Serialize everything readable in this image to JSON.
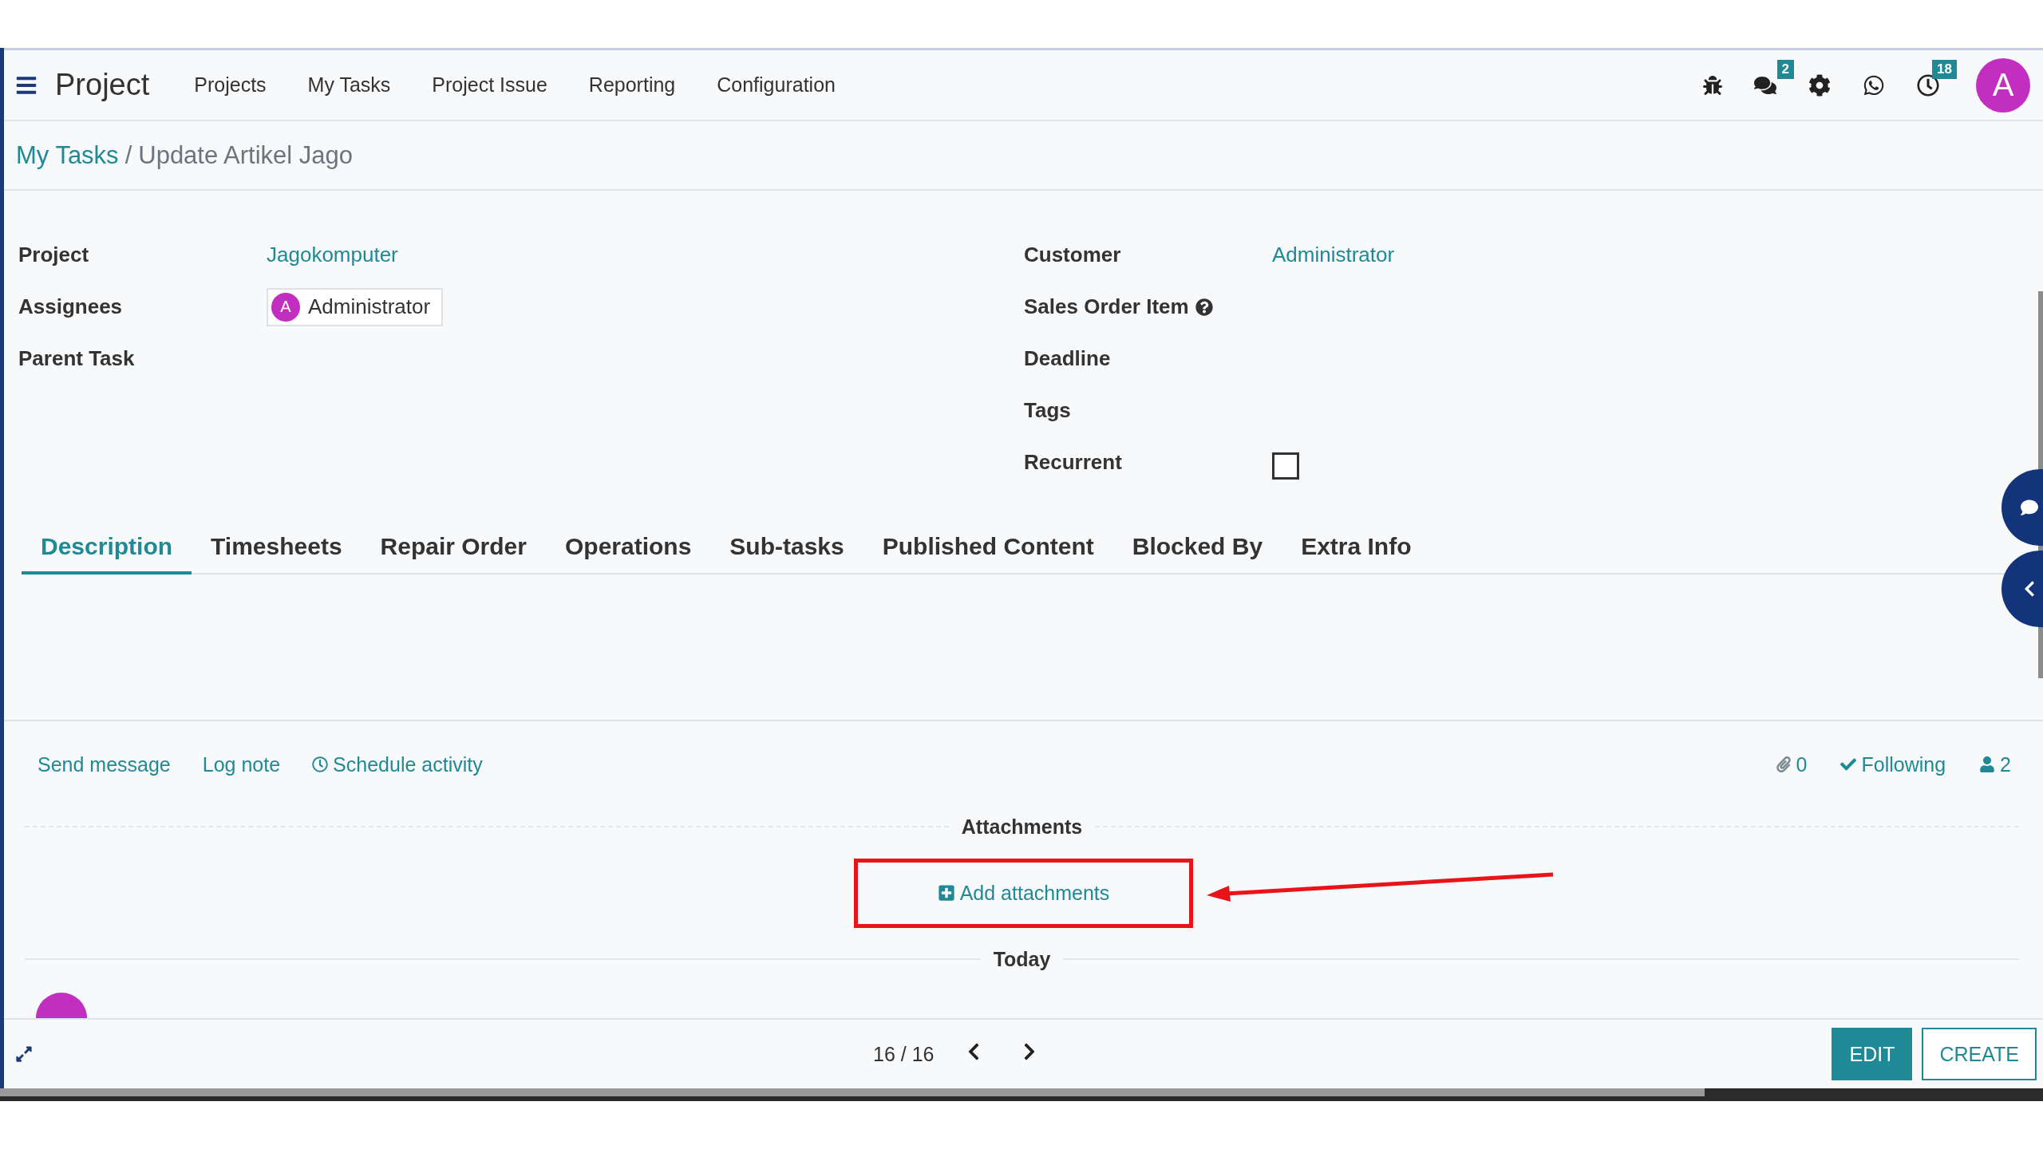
{
  "app": {
    "title": "Project",
    "menu": [
      "Projects",
      "My Tasks",
      "Project Issue",
      "Reporting",
      "Configuration"
    ],
    "systray": {
      "messages_badge": "2",
      "activities_badge": "18",
      "avatar": "A"
    }
  },
  "breadcrumb": {
    "parent": "My Tasks",
    "separator": "/",
    "current": "Update Artikel Jago"
  },
  "fields_left": [
    {
      "label": "Project",
      "value": "Jagokomputer",
      "kind": "link"
    },
    {
      "label": "Assignees",
      "value": "Administrator",
      "avatar": "A",
      "kind": "tag"
    },
    {
      "label": "Parent Task",
      "kind": "empty"
    }
  ],
  "fields_right": [
    {
      "label": "Customer",
      "value": "Administrator",
      "kind": "link"
    },
    {
      "label": "Sales Order Item",
      "kind": "help"
    },
    {
      "label": "Deadline",
      "kind": "empty"
    },
    {
      "label": "Tags",
      "kind": "empty"
    },
    {
      "label": "Recurrent",
      "kind": "checkbox",
      "checked": false
    }
  ],
  "tabs": [
    {
      "label": "Description",
      "selected": true
    },
    {
      "label": "Timesheets",
      "selected": false
    },
    {
      "label": "Repair Order",
      "selected": false
    },
    {
      "label": "Operations",
      "selected": false
    },
    {
      "label": "Sub-tasks",
      "selected": false
    },
    {
      "label": "Published Content",
      "selected": false
    },
    {
      "label": "Blocked By",
      "selected": false
    },
    {
      "label": "Extra Info",
      "selected": false
    }
  ],
  "chatter": {
    "actions": [
      {
        "label": "Send message",
        "kind": "plain"
      },
      {
        "label": "Log note",
        "kind": "plain"
      },
      {
        "label": "Schedule activity",
        "kind": "clock"
      }
    ],
    "attachments_count": "0",
    "follow_label": "Following",
    "following": true,
    "followers_count": "2",
    "attachments_title": "Attachments",
    "add_attachments": "Add attachments",
    "date_separator": "Today"
  },
  "pager": "16 / 16",
  "buttons": [
    {
      "label": "EDIT",
      "kind": "primary"
    },
    {
      "label": "CREATE",
      "kind": "secondary"
    }
  ]
}
